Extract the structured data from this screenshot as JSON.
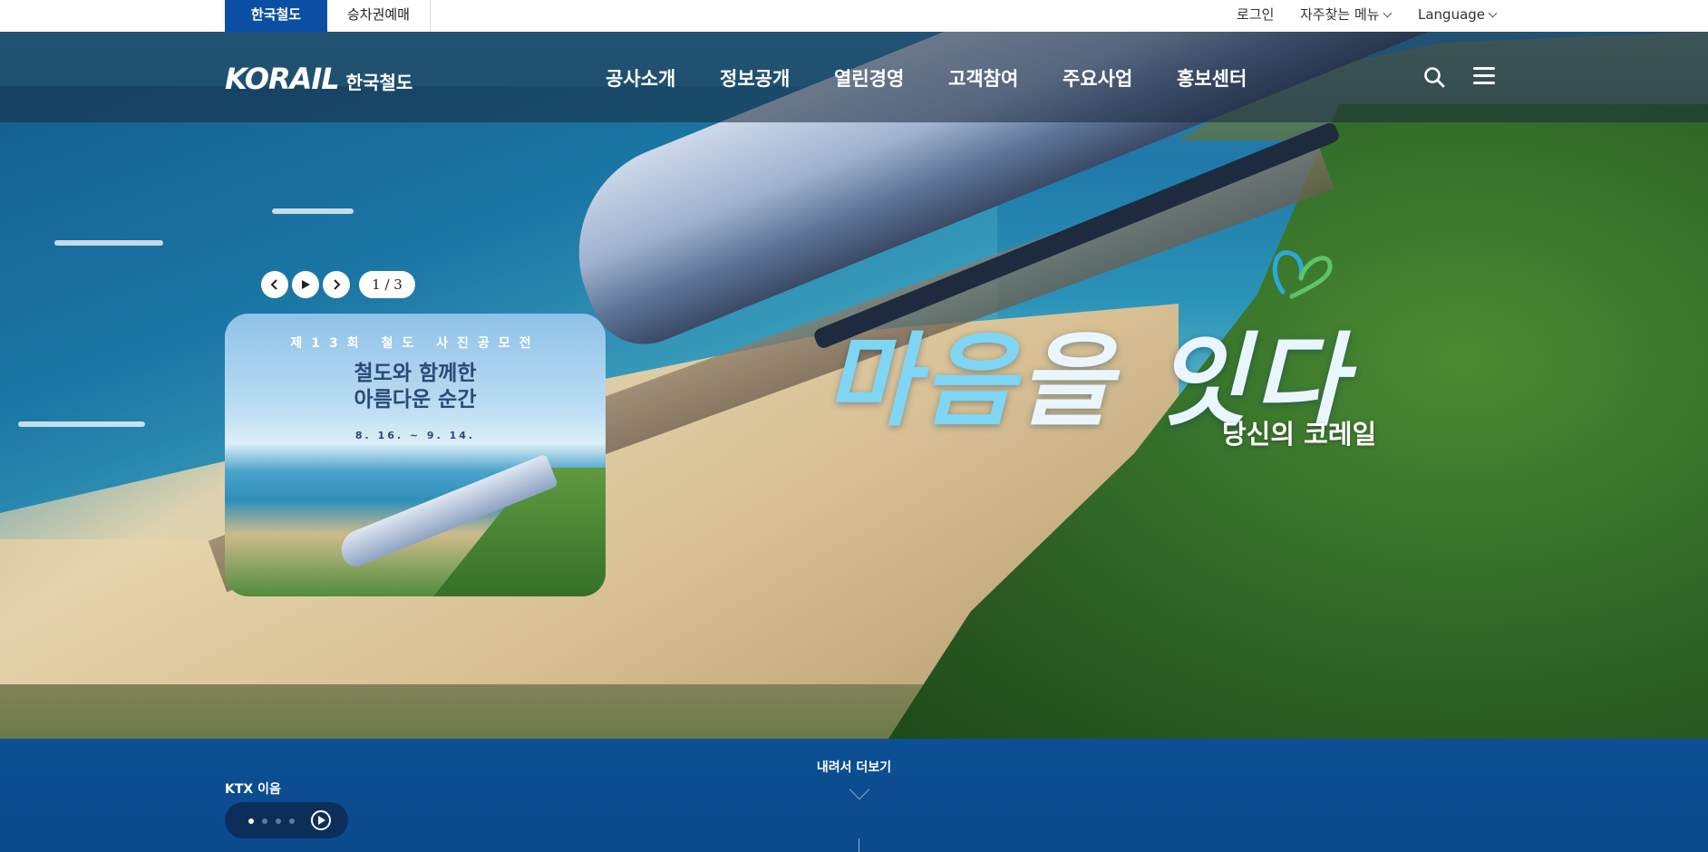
{
  "topbar": {
    "tabs": [
      {
        "label": "한국철도",
        "active": true
      },
      {
        "label": "승차권예매",
        "active": false
      }
    ],
    "util": {
      "login": "로그인",
      "favorites": "자주찾는 메뉴",
      "language": "Language"
    }
  },
  "header": {
    "logo_mark": "KORAIL",
    "logo_sub": "한국철도",
    "nav": [
      "공사소개",
      "정보공개",
      "열린경영",
      "고객참여",
      "주요사업",
      "홍보센터"
    ],
    "icons": [
      "search-icon",
      "hamburger-menu-icon"
    ]
  },
  "slider": {
    "counter": "1 / 3",
    "controls": [
      "chevron-left-icon",
      "play-icon",
      "chevron-right-icon"
    ]
  },
  "promo": {
    "subtitle": "제13회 철도 사진공모전",
    "title_line1": "철도와 함께한",
    "title_line2": "아름다운 순간",
    "date": "8. 16. ~ 9. 14."
  },
  "hero": {
    "slogan": "마음을 잇다",
    "slogan_sub": "당신의 코레일"
  },
  "bottom": {
    "scroll_text": "내려서 더보기",
    "ktx_label": "KTX 이음",
    "dots_total": 4,
    "dots_active": 1
  },
  "colors": {
    "brand_blue": "#0a4fa3",
    "bottom_band": "#0c4f94",
    "nav_overlay": "rgba(25,40,60,0.55)"
  }
}
